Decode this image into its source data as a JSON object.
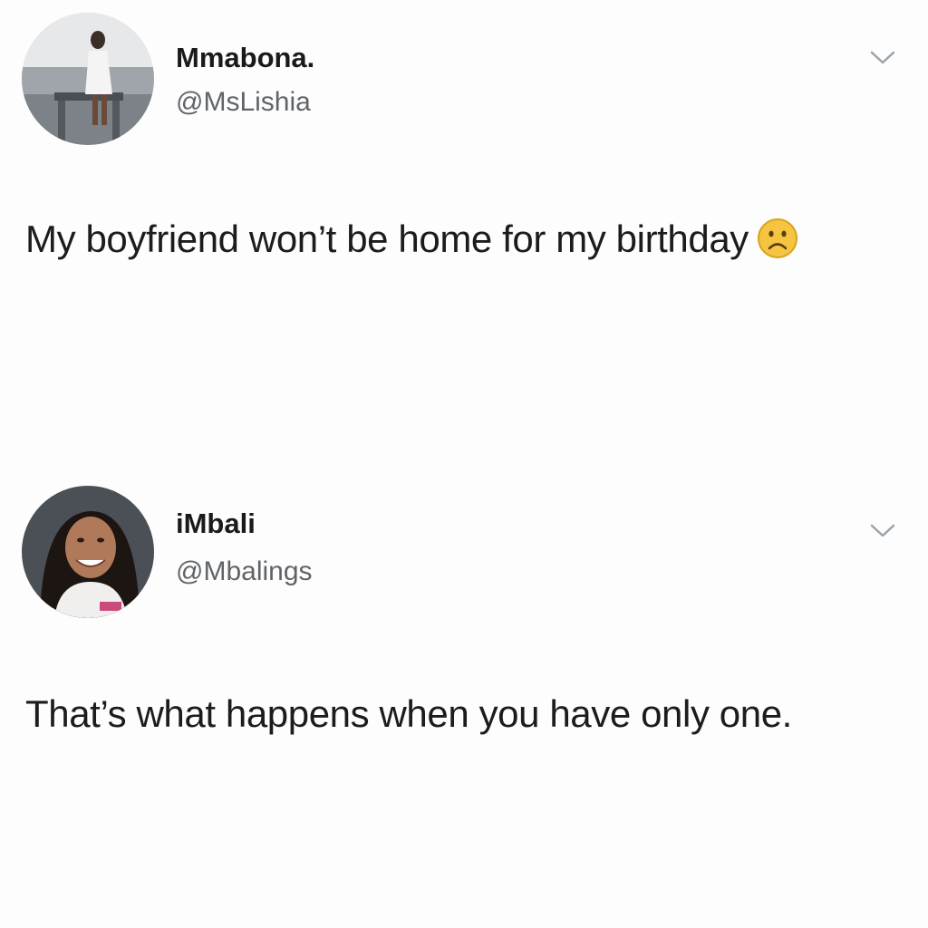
{
  "tweets": [
    {
      "display_name": "Mmabona.",
      "handle": "@MsLishia",
      "text": "My boyfriend won’t be home for my birthday",
      "trailing_emoji": "frowning-face",
      "menu_icon": "chevron-down-icon"
    },
    {
      "display_name": "iMbali",
      "handle": "@Mbalings",
      "text": "That’s what happens when you have only one.",
      "menu_icon": "chevron-down-icon"
    }
  ],
  "colors": {
    "name_text": "#1a1a1a",
    "handle_text": "#606468",
    "body_text": "#1c1c1c",
    "chevron": "#9aa3ab",
    "emoji_face": "#f5c542"
  }
}
